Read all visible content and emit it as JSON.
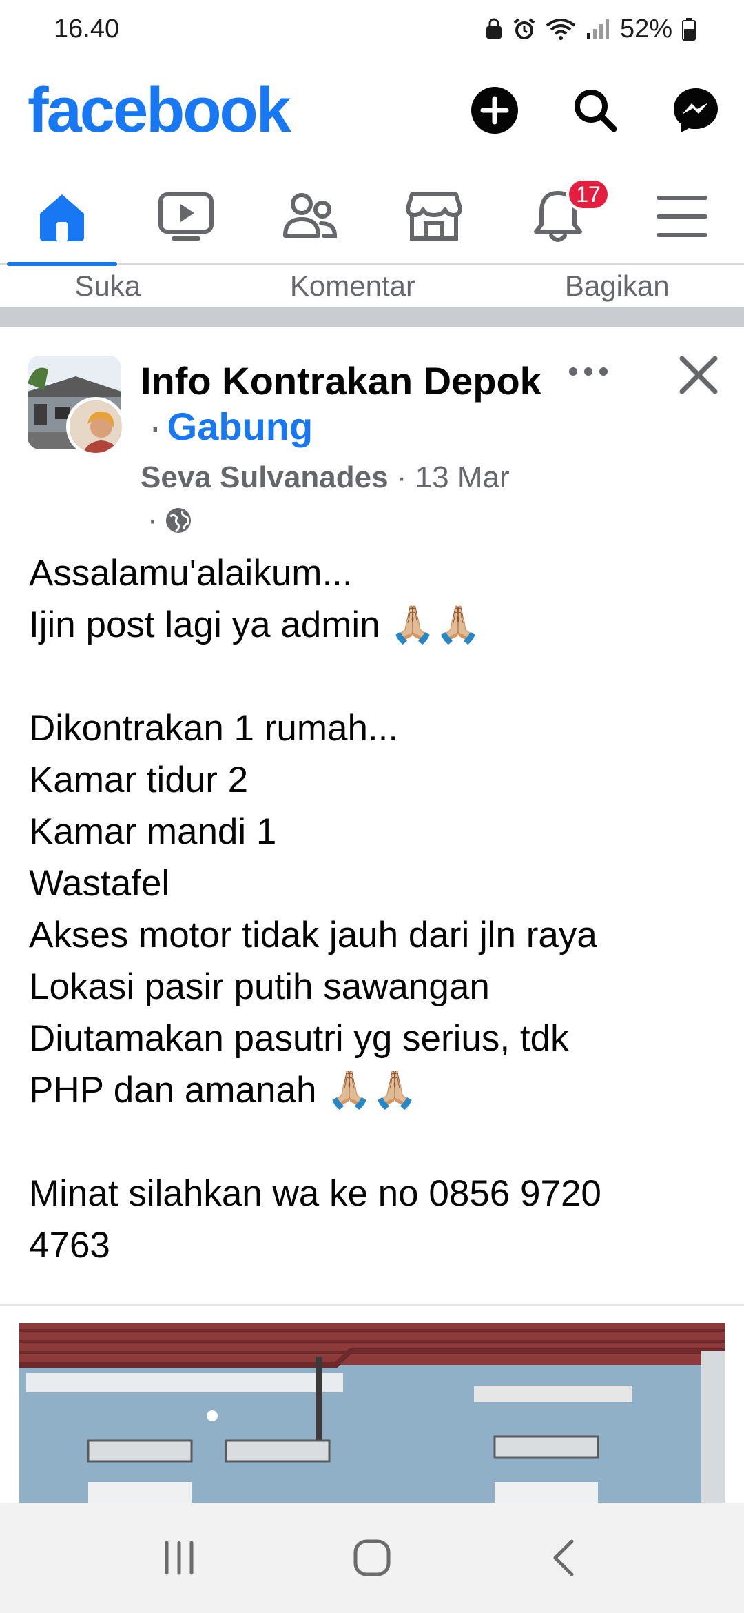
{
  "status_bar": {
    "time": "16.40",
    "battery": "52%"
  },
  "header": {
    "logo": "facebook",
    "icons": [
      "add-icon",
      "search-icon",
      "messenger-icon"
    ]
  },
  "nav": {
    "tabs": [
      "home-icon",
      "video-icon",
      "friends-icon",
      "marketplace-icon",
      "bell-icon",
      "menu-icon"
    ],
    "notification_badge": "17",
    "active_tab": "home",
    "accent_color": "#1877f2"
  },
  "reactions": {
    "like": "Suka",
    "comment": "Komentar",
    "share": "Bagikan"
  },
  "post": {
    "group_name": "Info Kontrakan Depok",
    "join_label": "Gabung",
    "author": "Seva Sulvanades",
    "date": "13 Mar",
    "privacy_icon": "globe-icon",
    "body": {
      "p1": "Assalamu'alaikum...\nIjin post lagi ya admin 🙏🏼🙏🏼",
      "p2": "Dikontrakan 1 rumah...\nKamar tidur 2\nKamar mandi 1\nWastafel\nAkses motor tidak jauh dari jln raya\nLokasi pasir putih sawangan\nDiutamakan pasutri yg serius, tdk\nPHP dan amanah 🙏🏼🙏🏼",
      "p3": "Minat silahkan wa ke no 0856 9720\n4763"
    }
  },
  "android_nav": [
    "recent-apps-icon",
    "home-circle-icon",
    "back-icon"
  ]
}
